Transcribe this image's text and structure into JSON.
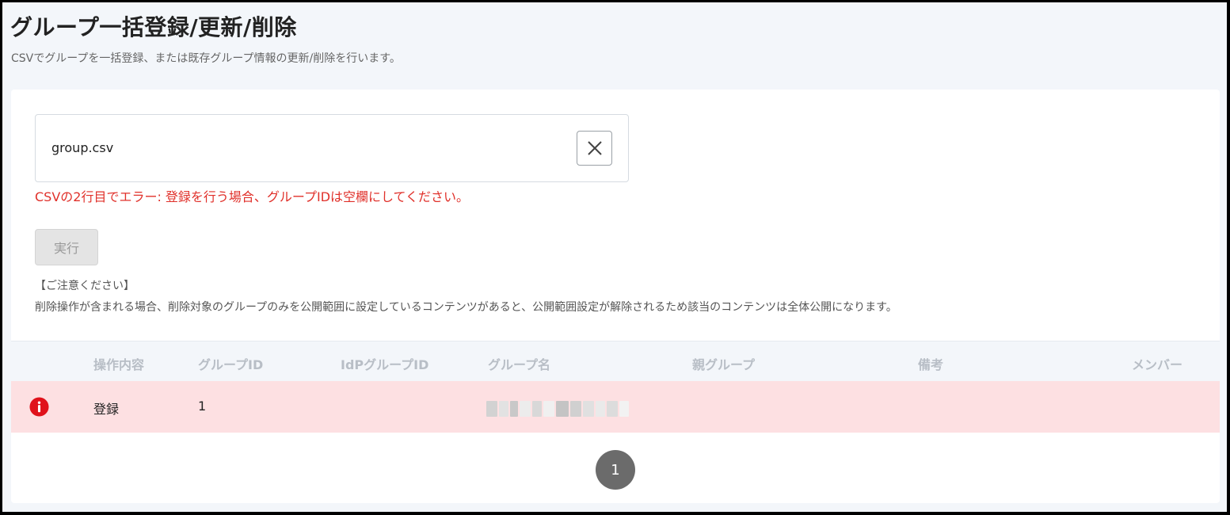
{
  "page": {
    "title": "グループ一括登録/更新/削除",
    "description": "CSVでグループを一括登録、または既存グループ情報の更新/削除を行います。"
  },
  "upload": {
    "file_name": "group.csv",
    "error": "CSVの2行目でエラー: 登録を行う場合、グループIDは空欄にしてください。",
    "clear_icon": "close-icon"
  },
  "run_button": {
    "label": "実行",
    "disabled": true
  },
  "notice": {
    "title": "【ご注意ください】",
    "body": "削除操作が含まれる場合、削除対象のグループのみを公開範囲に設定しているコンテンツがあると、公開範囲設定が解除されるため該当のコンテンツは全体公開になります。"
  },
  "table": {
    "columns": [
      "操作内容",
      "グループID",
      "IdPグループID",
      "グループ名",
      "親グループ",
      "備考",
      "メンバー"
    ],
    "rows": [
      {
        "status_icon": "info-icon",
        "status_color": "#e0121b",
        "operation": "登録",
        "group_id": "1",
        "idp_group_id": "",
        "group_name": "",
        "parent_group": "",
        "note": "",
        "members": ""
      }
    ]
  },
  "pagination": {
    "current_page": "1"
  },
  "colors": {
    "error": "#e0302a",
    "row_error_bg": "#fde0e2",
    "header_bg": "#f3f6fa",
    "pager_bg": "#6b6b6b"
  }
}
